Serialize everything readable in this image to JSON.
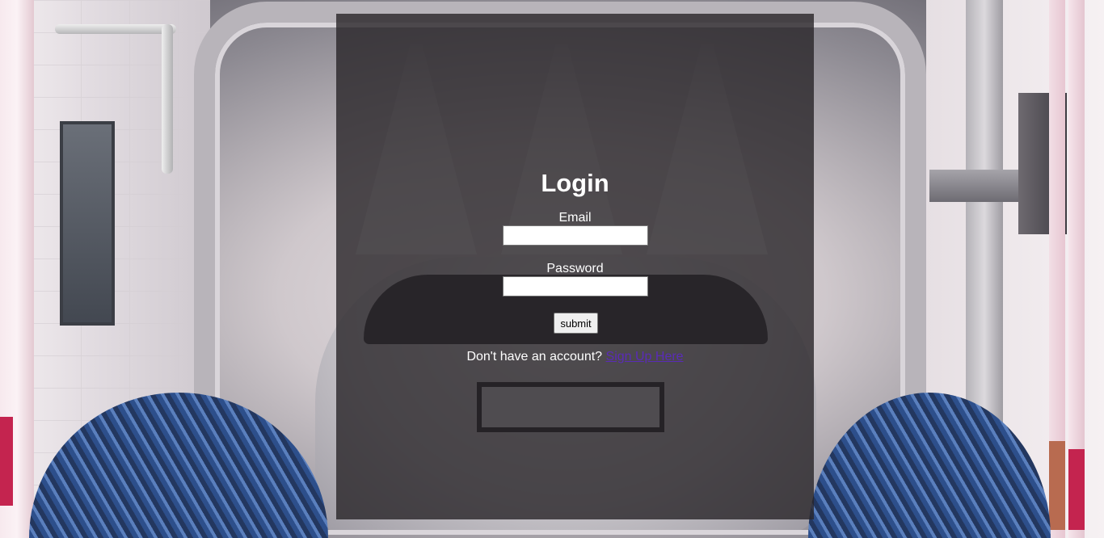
{
  "login": {
    "title": "Login",
    "email_label": "Email",
    "email_value": "",
    "password_label": "Password",
    "password_value": "",
    "submit_label": "submit",
    "no_account_text": "Don't have an account?",
    "signup_link": "Sign Up Here"
  },
  "colors": {
    "panel_overlay": "#282428",
    "link": "#5a2bb8",
    "text": "#ffffff"
  }
}
